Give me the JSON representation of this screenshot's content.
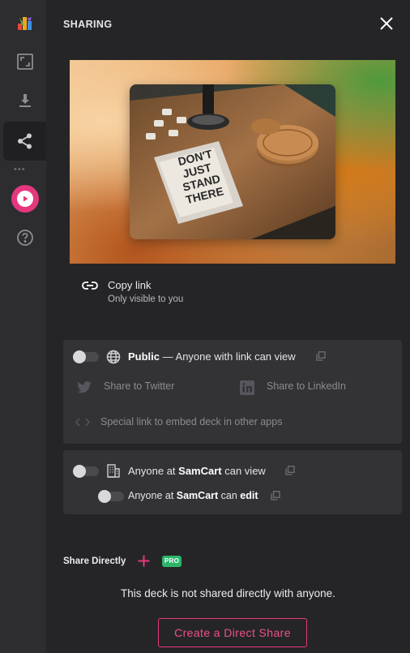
{
  "rail": {
    "items": [
      {
        "name": "logo",
        "icon": "app-logo-icon"
      },
      {
        "name": "fullscreen",
        "icon": "fullscreen-icon"
      },
      {
        "name": "download",
        "icon": "download-icon"
      },
      {
        "name": "share",
        "icon": "share-icon",
        "active": true
      },
      {
        "name": "more",
        "icon": "more-dots-icon"
      },
      {
        "name": "play",
        "icon": "play-icon",
        "color": "#e3387d"
      },
      {
        "name": "help",
        "icon": "help-icon"
      }
    ]
  },
  "panel": {
    "title": "SHARING",
    "close_icon": "close-icon"
  },
  "preview": {
    "book_title_lines": [
      "DON'T",
      "JUST",
      "STAND",
      "THERE"
    ]
  },
  "copy_link": {
    "label": "Copy link",
    "sublabel": "Only visible to you",
    "icon": "link-icon"
  },
  "public_card": {
    "toggle_on": false,
    "title_bold": "Public",
    "title_rest": " — Anyone with link can view",
    "share_twitter": "Share to Twitter",
    "share_linkedin": "Share to LinkedIn",
    "embed_label": "Special link to embed deck in other apps"
  },
  "org_card": {
    "view": {
      "prefix": "Anyone at ",
      "org": "SamCart",
      "suffix": " can view",
      "toggle_on": false
    },
    "edit": {
      "prefix": "Anyone at ",
      "org": "SamCart",
      "middle": " can ",
      "action": "edit",
      "toggle_on": false
    }
  },
  "share_directly": {
    "label": "Share Directly",
    "badge": "PRO",
    "empty_message": "This deck is not shared directly with anyone.",
    "create_button": "Create a Direct Share"
  },
  "colors": {
    "accent": "#e3387d",
    "pro_badge": "#2cb56a",
    "panel_bg": "#252527",
    "card_bg": "#333336"
  }
}
